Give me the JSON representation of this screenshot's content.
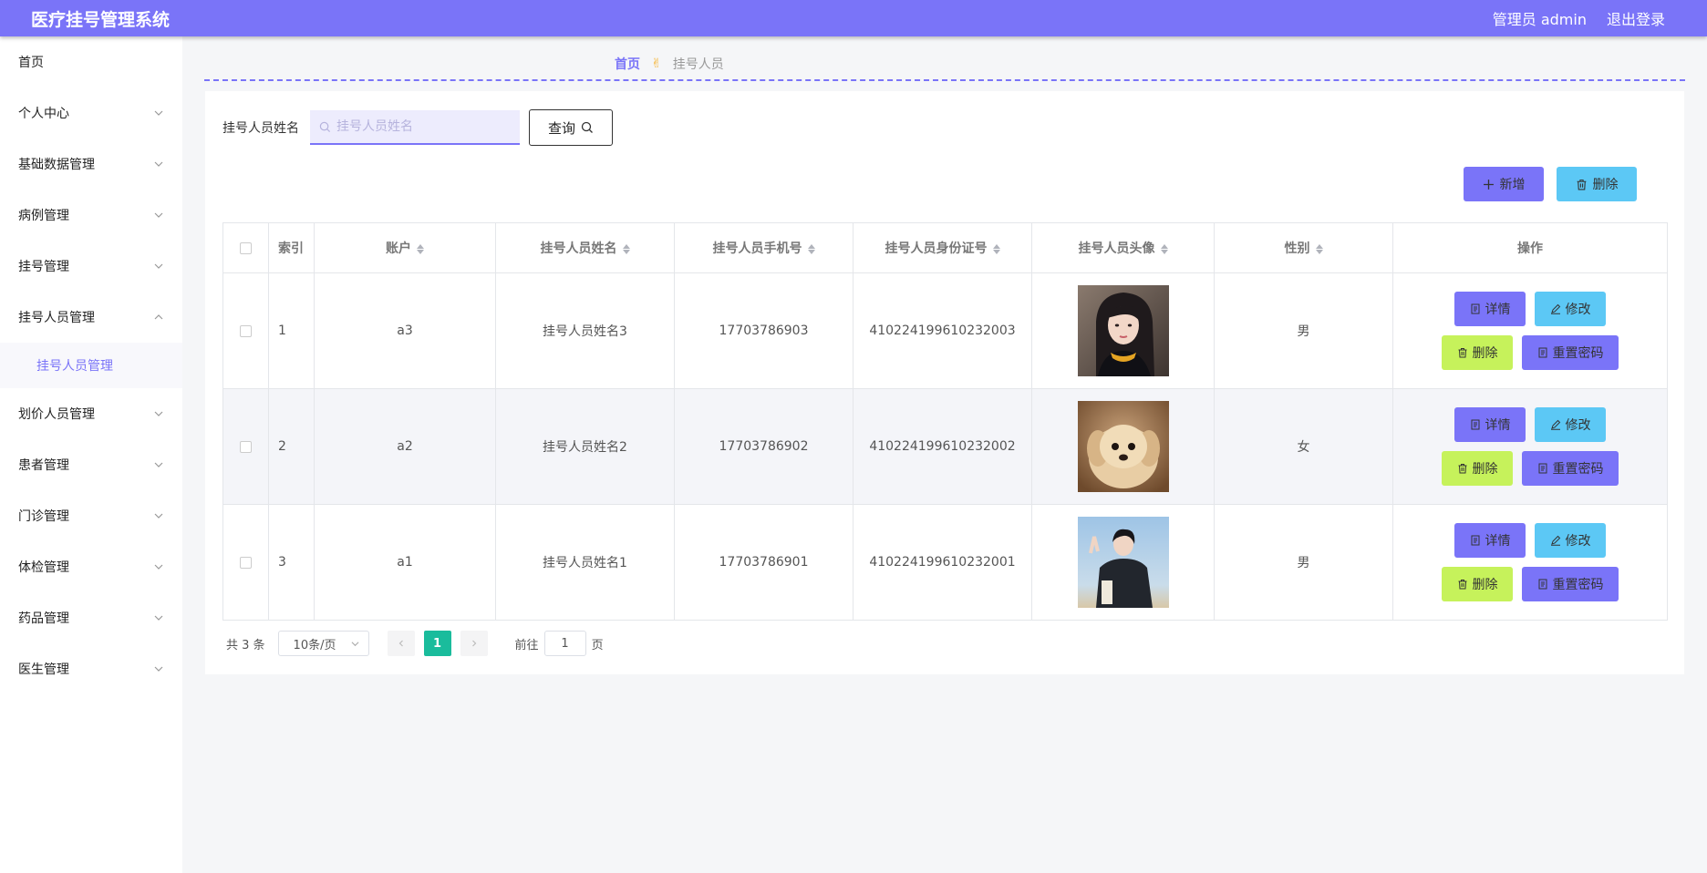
{
  "header": {
    "title": "医疗挂号管理系统",
    "user": "管理员 admin",
    "logout": "退出登录"
  },
  "sidebar": {
    "items": [
      {
        "label": "首页"
      },
      {
        "label": "个人中心"
      },
      {
        "label": "基础数据管理"
      },
      {
        "label": "病例管理"
      },
      {
        "label": "挂号管理"
      },
      {
        "label": "挂号人员管理"
      },
      {
        "label": "挂号人员管理"
      },
      {
        "label": "划价人员管理"
      },
      {
        "label": "患者管理"
      },
      {
        "label": "门诊管理"
      },
      {
        "label": "体检管理"
      },
      {
        "label": "药品管理"
      },
      {
        "label": "医生管理"
      }
    ]
  },
  "breadcrumb": {
    "home": "首页",
    "sep": "✌",
    "current": "挂号人员"
  },
  "search": {
    "label": "挂号人员姓名",
    "placeholder": "挂号人员姓名",
    "value": "",
    "button": "查询"
  },
  "actions": {
    "add": "新增",
    "delete": "删除"
  },
  "table": {
    "columns": [
      "索引",
      "账户",
      "挂号人员姓名",
      "挂号人员手机号",
      "挂号人员身份证号",
      "挂号人员头像",
      "性别",
      "操作"
    ],
    "rows": [
      {
        "index": "1",
        "account": "a3",
        "name": "挂号人员姓名3",
        "phone": "17703786903",
        "id_card": "410224199610232003",
        "avatar": "woman-portrait",
        "gender": "男"
      },
      {
        "index": "2",
        "account": "a2",
        "name": "挂号人员姓名2",
        "phone": "17703786902",
        "id_card": "410224199610232002",
        "avatar": "puppy",
        "gender": "女"
      },
      {
        "index": "3",
        "account": "a1",
        "name": "挂号人员姓名1",
        "phone": "17703786901",
        "id_card": "410224199610232001",
        "avatar": "man-portrait",
        "gender": "男"
      }
    ],
    "ops": {
      "detail": "详情",
      "edit": "修改",
      "remove": "删除",
      "reset": "重置密码"
    }
  },
  "pagination": {
    "total": "共 3 条",
    "page_size": "10条/页",
    "current_page": "1",
    "goto_label": "前往",
    "goto_value": "1",
    "goto_suffix": "页"
  },
  "colors": {
    "primary": "#7a74f8",
    "info": "#5cc8f5",
    "warning": "#c6f25b",
    "pager_active": "#1abc9c"
  }
}
